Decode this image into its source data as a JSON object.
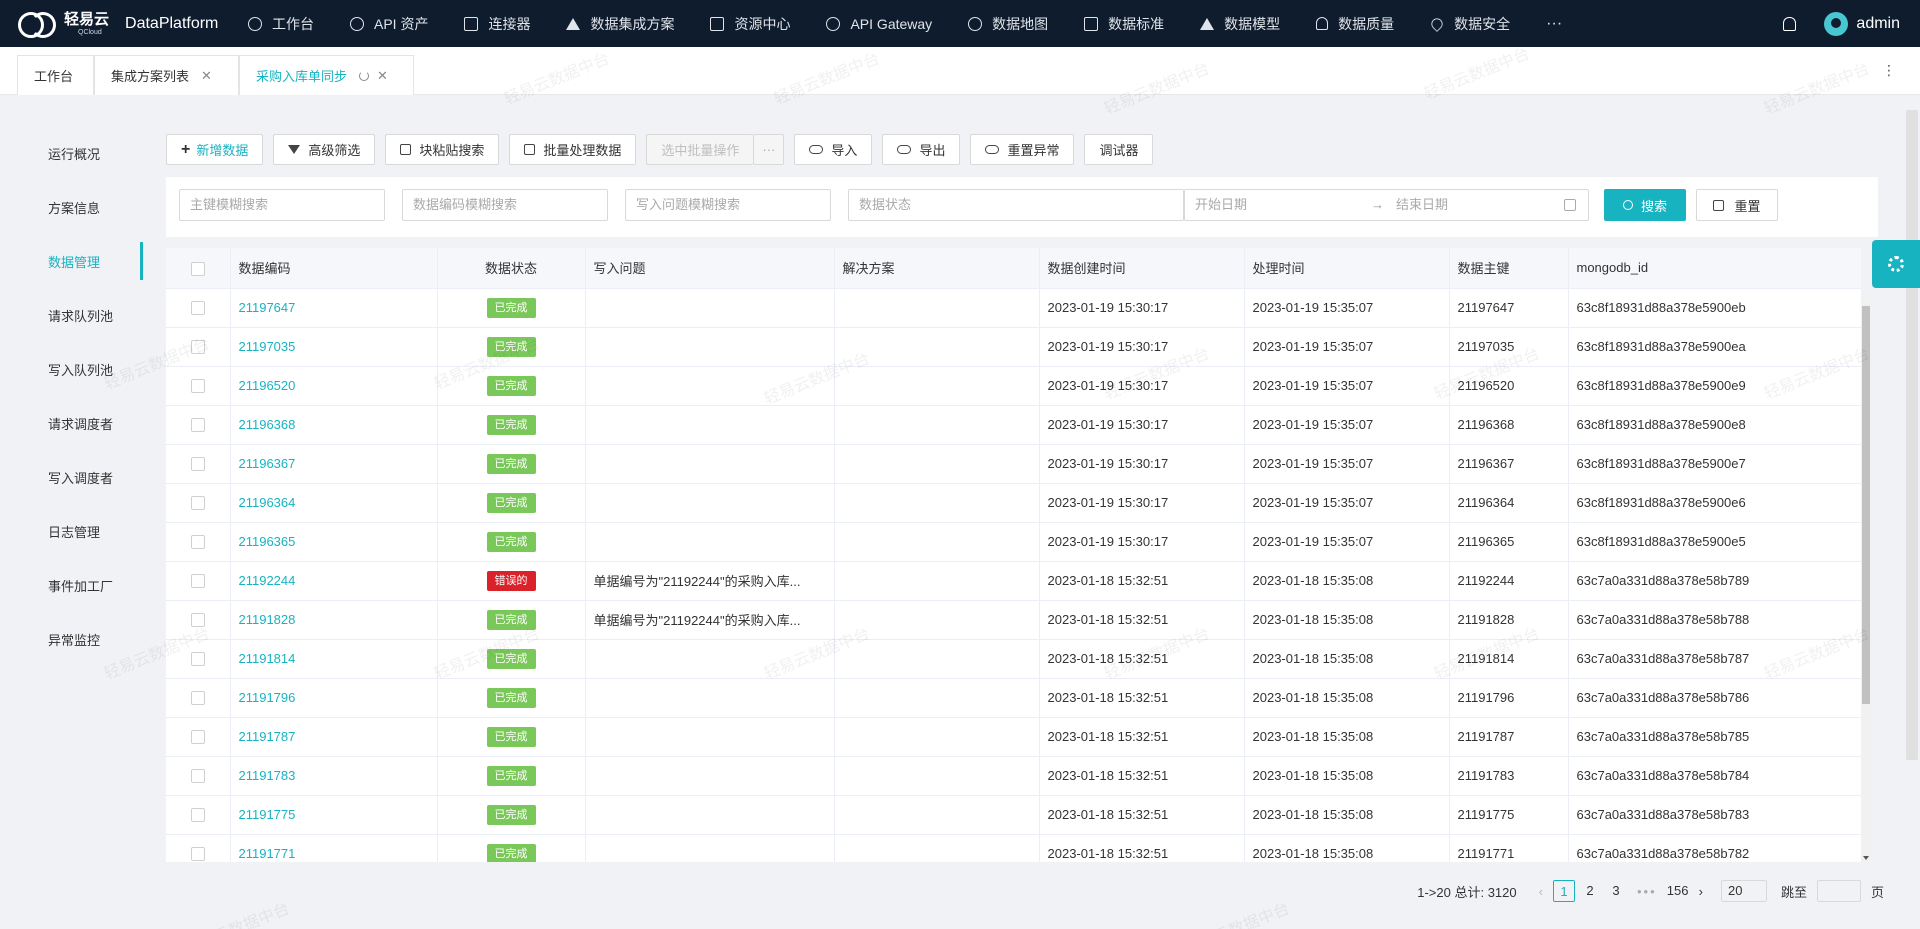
{
  "nav": {
    "brand_cn": "轻易云",
    "brand_en": "QCloud",
    "product": "DataPlatform",
    "items": [
      {
        "label": "工作台",
        "icon": "clock-icon"
      },
      {
        "label": "API 资产",
        "icon": "compass-icon"
      },
      {
        "label": "连接器",
        "icon": "network-icon"
      },
      {
        "label": "数据集成方案",
        "icon": "flow-icon"
      },
      {
        "label": "资源中心",
        "icon": "resource-icon"
      },
      {
        "label": "API Gateway",
        "icon": "rocket-icon"
      },
      {
        "label": "数据地图",
        "icon": "globe-icon"
      },
      {
        "label": "数据标准",
        "icon": "document-icon"
      },
      {
        "label": "数据模型",
        "icon": "triangle-icon"
      },
      {
        "label": "数据质量",
        "icon": "bell-icon"
      },
      {
        "label": "数据安全",
        "icon": "heart-icon"
      }
    ],
    "more": "···",
    "user": "admin"
  },
  "tabs": [
    {
      "label": "工作台"
    },
    {
      "label": "集成方案列表"
    },
    {
      "label": "采购入库单同步"
    }
  ],
  "sidebar": {
    "items": [
      "运行概况",
      "方案信息",
      "数据管理",
      "请求队列池",
      "写入队列池",
      "请求调度者",
      "写入调度者",
      "日志管理",
      "事件加工厂",
      "异常监控"
    ],
    "active": "数据管理"
  },
  "toolbar": {
    "add": "新增数据",
    "filter": "高级筛选",
    "paste_search": "块粘贴搜索",
    "batch": "批量处理数据",
    "batch_selected": "选中批量操作",
    "more": "···",
    "import": "导入",
    "export": "导出",
    "reset_error": "重置异常",
    "debugger": "调试器"
  },
  "filters": {
    "key_placeholder": "主键模糊搜索",
    "code_placeholder": "数据编码模糊搜索",
    "issue_placeholder": "写入问题模糊搜索",
    "status_placeholder": "数据状态",
    "start_placeholder": "开始日期",
    "date_sep": "→",
    "end_placeholder": "结束日期",
    "search": "搜索",
    "reset": "重置"
  },
  "table": {
    "columns": [
      "数据编码",
      "数据状态",
      "写入问题",
      "解决方案",
      "数据创建时间",
      "处理时间",
      "数据主键",
      "mongodb_id"
    ],
    "rows": [
      {
        "code": "21197647",
        "status": "已完成",
        "status_type": "done",
        "issue": "",
        "solution": "",
        "created": "2023-01-19 15:30:17",
        "processed": "2023-01-19 15:35:07",
        "key": "21197647",
        "mongo": "63c8f18931d88a378e5900eb"
      },
      {
        "code": "21197035",
        "status": "已完成",
        "status_type": "done",
        "issue": "",
        "solution": "",
        "created": "2023-01-19 15:30:17",
        "processed": "2023-01-19 15:35:07",
        "key": "21197035",
        "mongo": "63c8f18931d88a378e5900ea"
      },
      {
        "code": "21196520",
        "status": "已完成",
        "status_type": "done",
        "issue": "",
        "solution": "",
        "created": "2023-01-19 15:30:17",
        "processed": "2023-01-19 15:35:07",
        "key": "21196520",
        "mongo": "63c8f18931d88a378e5900e9"
      },
      {
        "code": "21196368",
        "status": "已完成",
        "status_type": "done",
        "issue": "",
        "solution": "",
        "created": "2023-01-19 15:30:17",
        "processed": "2023-01-19 15:35:07",
        "key": "21196368",
        "mongo": "63c8f18931d88a378e5900e8"
      },
      {
        "code": "21196367",
        "status": "已完成",
        "status_type": "done",
        "issue": "",
        "solution": "",
        "created": "2023-01-19 15:30:17",
        "processed": "2023-01-19 15:35:07",
        "key": "21196367",
        "mongo": "63c8f18931d88a378e5900e7"
      },
      {
        "code": "21196364",
        "status": "已完成",
        "status_type": "done",
        "issue": "",
        "solution": "",
        "created": "2023-01-19 15:30:17",
        "processed": "2023-01-19 15:35:07",
        "key": "21196364",
        "mongo": "63c8f18931d88a378e5900e6"
      },
      {
        "code": "21196365",
        "status": "已完成",
        "status_type": "done",
        "issue": "",
        "solution": "",
        "created": "2023-01-19 15:30:17",
        "processed": "2023-01-19 15:35:07",
        "key": "21196365",
        "mongo": "63c8f18931d88a378e5900e5"
      },
      {
        "code": "21192244",
        "status": "错误的",
        "status_type": "err",
        "issue": "单据编号为\"21192244\"的采购入库...",
        "solution": "",
        "created": "2023-01-18 15:32:51",
        "processed": "2023-01-18 15:35:08",
        "key": "21192244",
        "mongo": "63c7a0a331d88a378e58b789"
      },
      {
        "code": "21191828",
        "status": "已完成",
        "status_type": "done",
        "issue": "单据编号为\"21192244\"的采购入库...",
        "solution": "",
        "created": "2023-01-18 15:32:51",
        "processed": "2023-01-18 15:35:08",
        "key": "21191828",
        "mongo": "63c7a0a331d88a378e58b788"
      },
      {
        "code": "21191814",
        "status": "已完成",
        "status_type": "done",
        "issue": "",
        "solution": "",
        "created": "2023-01-18 15:32:51",
        "processed": "2023-01-18 15:35:08",
        "key": "21191814",
        "mongo": "63c7a0a331d88a378e58b787"
      },
      {
        "code": "21191796",
        "status": "已完成",
        "status_type": "done",
        "issue": "",
        "solution": "",
        "created": "2023-01-18 15:32:51",
        "processed": "2023-01-18 15:35:08",
        "key": "21191796",
        "mongo": "63c7a0a331d88a378e58b786"
      },
      {
        "code": "21191787",
        "status": "已完成",
        "status_type": "done",
        "issue": "",
        "solution": "",
        "created": "2023-01-18 15:32:51",
        "processed": "2023-01-18 15:35:08",
        "key": "21191787",
        "mongo": "63c7a0a331d88a378e58b785"
      },
      {
        "code": "21191783",
        "status": "已完成",
        "status_type": "done",
        "issue": "",
        "solution": "",
        "created": "2023-01-18 15:32:51",
        "processed": "2023-01-18 15:35:08",
        "key": "21191783",
        "mongo": "63c7a0a331d88a378e58b784"
      },
      {
        "code": "21191775",
        "status": "已完成",
        "status_type": "done",
        "issue": "",
        "solution": "",
        "created": "2023-01-18 15:32:51",
        "processed": "2023-01-18 15:35:08",
        "key": "21191775",
        "mongo": "63c7a0a331d88a378e58b783"
      },
      {
        "code": "21191771",
        "status": "已完成",
        "status_type": "done",
        "issue": "",
        "solution": "",
        "created": "2023-01-18 15:32:51",
        "processed": "2023-01-18 15:35:08",
        "key": "21191771",
        "mongo": "63c7a0a331d88a378e58b782"
      }
    ]
  },
  "pager": {
    "info": "1->20 总计: 3120",
    "pages": [
      "1",
      "2",
      "3"
    ],
    "current": "1",
    "dots": "•••",
    "last": "156",
    "page_size": "20",
    "jump_label": "跳至",
    "page_unit": "页"
  },
  "watermark": "轻易云数据中台",
  "colors": {
    "accent": "#18b3c1",
    "nav_bg": "#0f1c2e",
    "done": "#7bc85a",
    "error": "#d9222a"
  }
}
